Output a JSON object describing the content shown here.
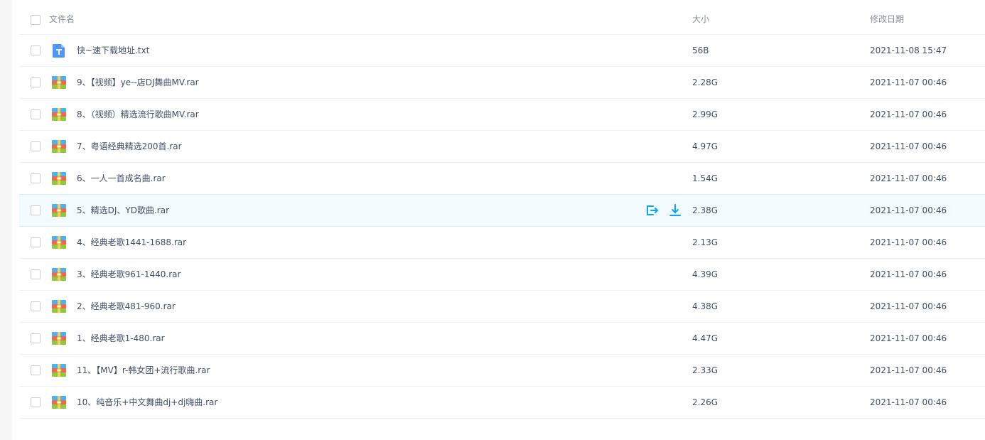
{
  "header": {
    "select_all": false,
    "name": "文件名",
    "size": "大小",
    "date": "修改日期"
  },
  "actions": {
    "share_icon": "share-icon",
    "download_icon": "download-icon",
    "color": "#06a7ff"
  },
  "rows": [
    {
      "name": "快~速下载地址.txt",
      "size": "56B",
      "date": "2021-11-08 15:47",
      "type": "txt"
    },
    {
      "name": "9、【视频】ye--店DJ舞曲MV.rar",
      "size": "2.28G",
      "date": "2021-11-07 00:46",
      "type": "rar"
    },
    {
      "name": "8、（视频）精选流行歌曲MV.rar",
      "size": "2.99G",
      "date": "2021-11-07 00:46",
      "type": "rar"
    },
    {
      "name": "7、粤语经典精选200首.rar",
      "size": "4.97G",
      "date": "2021-11-07 00:46",
      "type": "rar"
    },
    {
      "name": "6、一人一首成名曲.rar",
      "size": "1.54G",
      "date": "2021-11-07 00:46",
      "type": "rar"
    },
    {
      "name": "5、精选DJ、YD歌曲.rar",
      "size": "2.38G",
      "date": "2021-11-07 00:46",
      "type": "rar",
      "hover": true
    },
    {
      "name": "4、经典老歌1441-1688.rar",
      "size": "2.13G",
      "date": "2021-11-07 00:46",
      "type": "rar"
    },
    {
      "name": "3、经典老歌961-1440.rar",
      "size": "4.39G",
      "date": "2021-11-07 00:46",
      "type": "rar"
    },
    {
      "name": "2、经典老歌481-960.rar",
      "size": "4.38G",
      "date": "2021-11-07 00:46",
      "type": "rar"
    },
    {
      "name": "1、经典老歌1-480.rar",
      "size": "4.47G",
      "date": "2021-11-07 00:46",
      "type": "rar"
    },
    {
      "name": "11、【MV】r-韩女团+流行歌曲.rar",
      "size": "2.33G",
      "date": "2021-11-07 00:46",
      "type": "rar"
    },
    {
      "name": "10、纯音乐+中文舞曲dj+dj嗨曲.rar",
      "size": "2.26G",
      "date": "2021-11-07 00:46",
      "type": "rar"
    }
  ]
}
